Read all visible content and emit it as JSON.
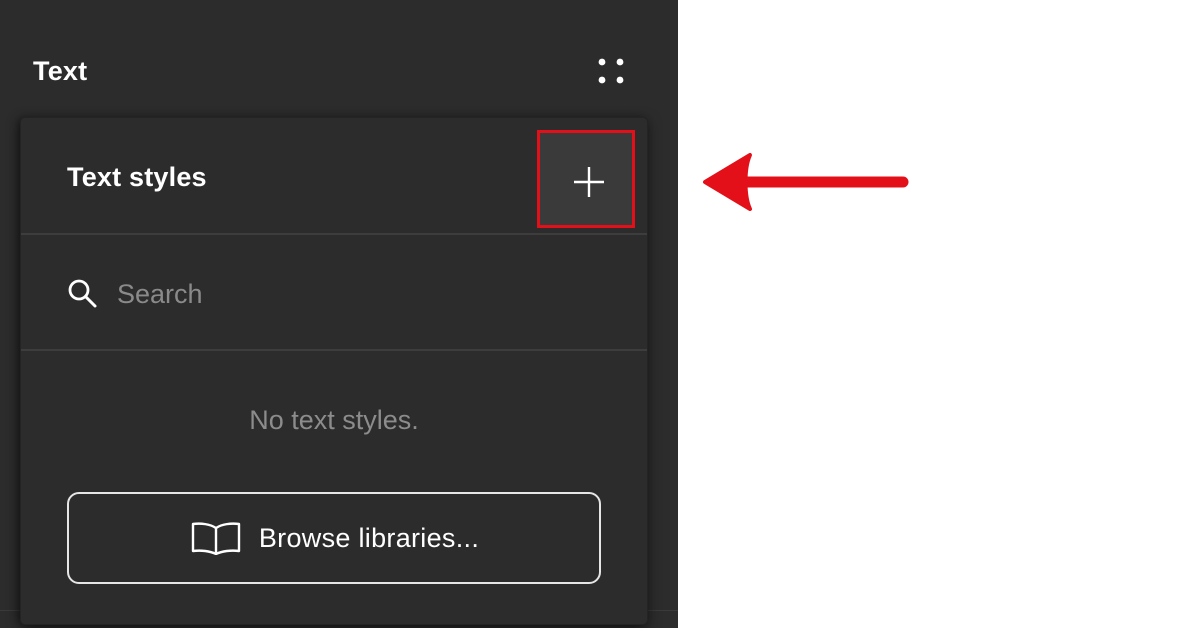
{
  "panel": {
    "title": "Text",
    "grid_icon": "grid-dots-icon"
  },
  "popover": {
    "title": "Text styles",
    "add_icon": "plus-icon",
    "search": {
      "icon": "search-icon",
      "placeholder": "Search",
      "value": ""
    },
    "empty_message": "No text styles.",
    "browse": {
      "icon": "book-icon",
      "label": "Browse libraries..."
    }
  },
  "annotation": {
    "highlight_color": "#e3101a",
    "arrow_color": "#e3101a",
    "arrow_icon": "arrow-left-icon"
  },
  "colors": {
    "panel_bg": "#2c2c2c",
    "divider": "#3d3d3d",
    "text_primary": "#ffffff",
    "text_muted": "#8c8c8c"
  }
}
